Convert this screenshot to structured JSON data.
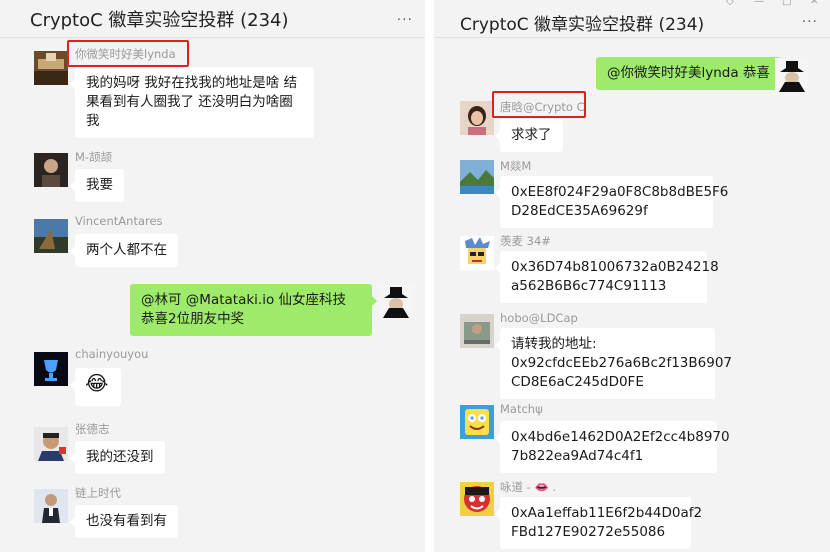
{
  "left": {
    "title": "CryptoC 徽章实验空投群 (234)",
    "more": "···",
    "messages": [
      {
        "name": "你微笑时好美lynda",
        "lines": [
          "我的妈呀 我好在找我的地址是啥 结",
          "果看到有人圈我了 还没明白为啥圈",
          "我"
        ]
      },
      {
        "name": "M-颉颉",
        "lines": [
          "我要"
        ]
      },
      {
        "name": "VincentAntares",
        "lines": [
          "两个人都不在"
        ]
      },
      {
        "lines": [
          "@林可 @Matataki.io 仙女座科技",
          "恭喜2位朋友中奖"
        ]
      },
      {
        "name": "chainyouyou",
        "emoji": "😂"
      },
      {
        "name": "张德志",
        "lines": [
          "我的还没到"
        ]
      },
      {
        "name": "链上时代",
        "lines": [
          "也没有看到有"
        ]
      }
    ]
  },
  "right": {
    "title": "CryptoC 徽章实验空投群 (234)",
    "more": "···",
    "window_controls": [
      "◇",
      "—",
      "□",
      "✕"
    ],
    "messages": [
      {
        "lines": [
          "@你微笑时好美lynda 恭喜"
        ]
      },
      {
        "name": "唐晗@Crypto C",
        "lines": [
          "求求了"
        ]
      },
      {
        "name": "M燚M",
        "lines": [
          "0xEE8f024F29a0F8C8b8dBE5F6",
          "D28EdCE35A69629f"
        ]
      },
      {
        "name": "羡麦 34#",
        "lines": [
          "0x36D74b81006732a0B24218",
          "a562B6B6c774C91113"
        ]
      },
      {
        "name": "hobo@LDCap",
        "lines": [
          "请转我的地址:",
          "0x92cfdcEEb276a6Bc2f13B6907",
          "CD8E6aC245dD0FE"
        ]
      },
      {
        "name": "Matchψ",
        "lines": [
          "0x4bd6e1462D0A2Ef2cc4b8970",
          "7b822ea9Ad74c4f1"
        ]
      },
      {
        "name": "咏道 - 👄 .",
        "lines": [
          "0xAa1effab11E6f2b44D0af2",
          "FBd127E90272e55086"
        ]
      }
    ]
  }
}
